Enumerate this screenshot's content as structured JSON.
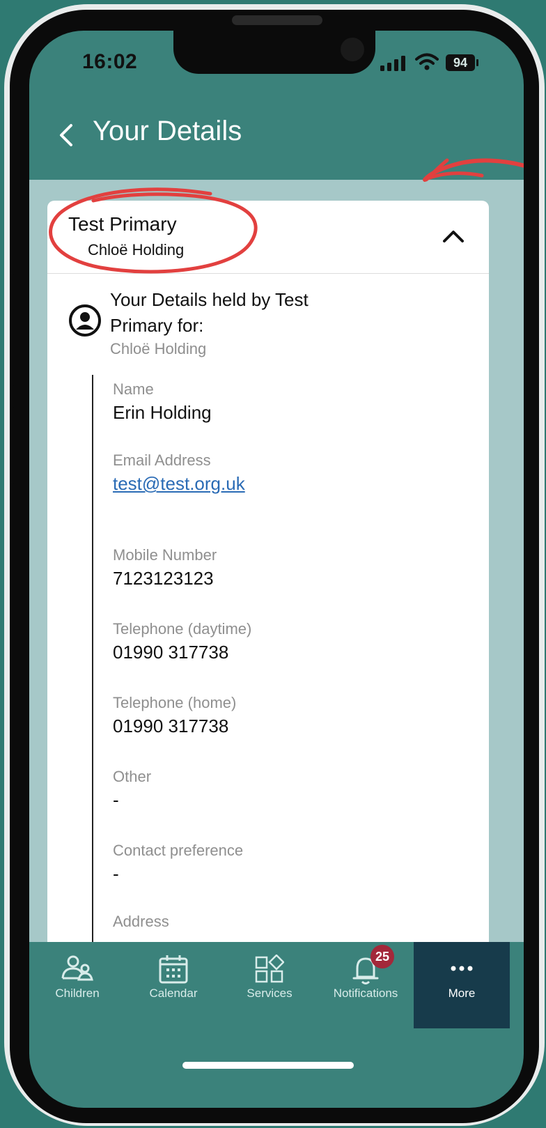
{
  "status": {
    "time": "16:02",
    "battery": "94"
  },
  "header": {
    "title": "Your Details"
  },
  "card": {
    "school": "Test Primary",
    "child": "Chloë Holding",
    "heading": "Your Details held by Test Primary for:",
    "for_child": "Chloë Holding"
  },
  "fields": [
    {
      "label": "Name",
      "value": "Erin Holding"
    },
    {
      "label": "Email Address",
      "value": "test@test.org.uk"
    },
    {
      "label": "Mobile Number",
      "value": "7123123123"
    },
    {
      "label": "Telephone (daytime)",
      "value": "01990 317738"
    },
    {
      "label": "Telephone (home)",
      "value": "01990 317738"
    },
    {
      "label": "Other",
      "value": "-"
    },
    {
      "label": "Contact preference",
      "value": "-"
    },
    {
      "label": "Address",
      "value": ""
    }
  ],
  "nav": {
    "items": [
      {
        "label": "Children",
        "icon": "children-icon"
      },
      {
        "label": "Calendar",
        "icon": "calendar-icon"
      },
      {
        "label": "Services",
        "icon": "services-icon"
      },
      {
        "label": "Notifications",
        "icon": "bell-icon",
        "badge": "25"
      },
      {
        "label": "More",
        "icon": "more-icon",
        "active": true
      }
    ]
  },
  "colors": {
    "header": "#3b827b",
    "content_bg": "#a6c8c8",
    "active_nav": "#173b4b",
    "badge": "#a3283a",
    "annotation": "#e2403f",
    "link": "#2a6bb5"
  }
}
